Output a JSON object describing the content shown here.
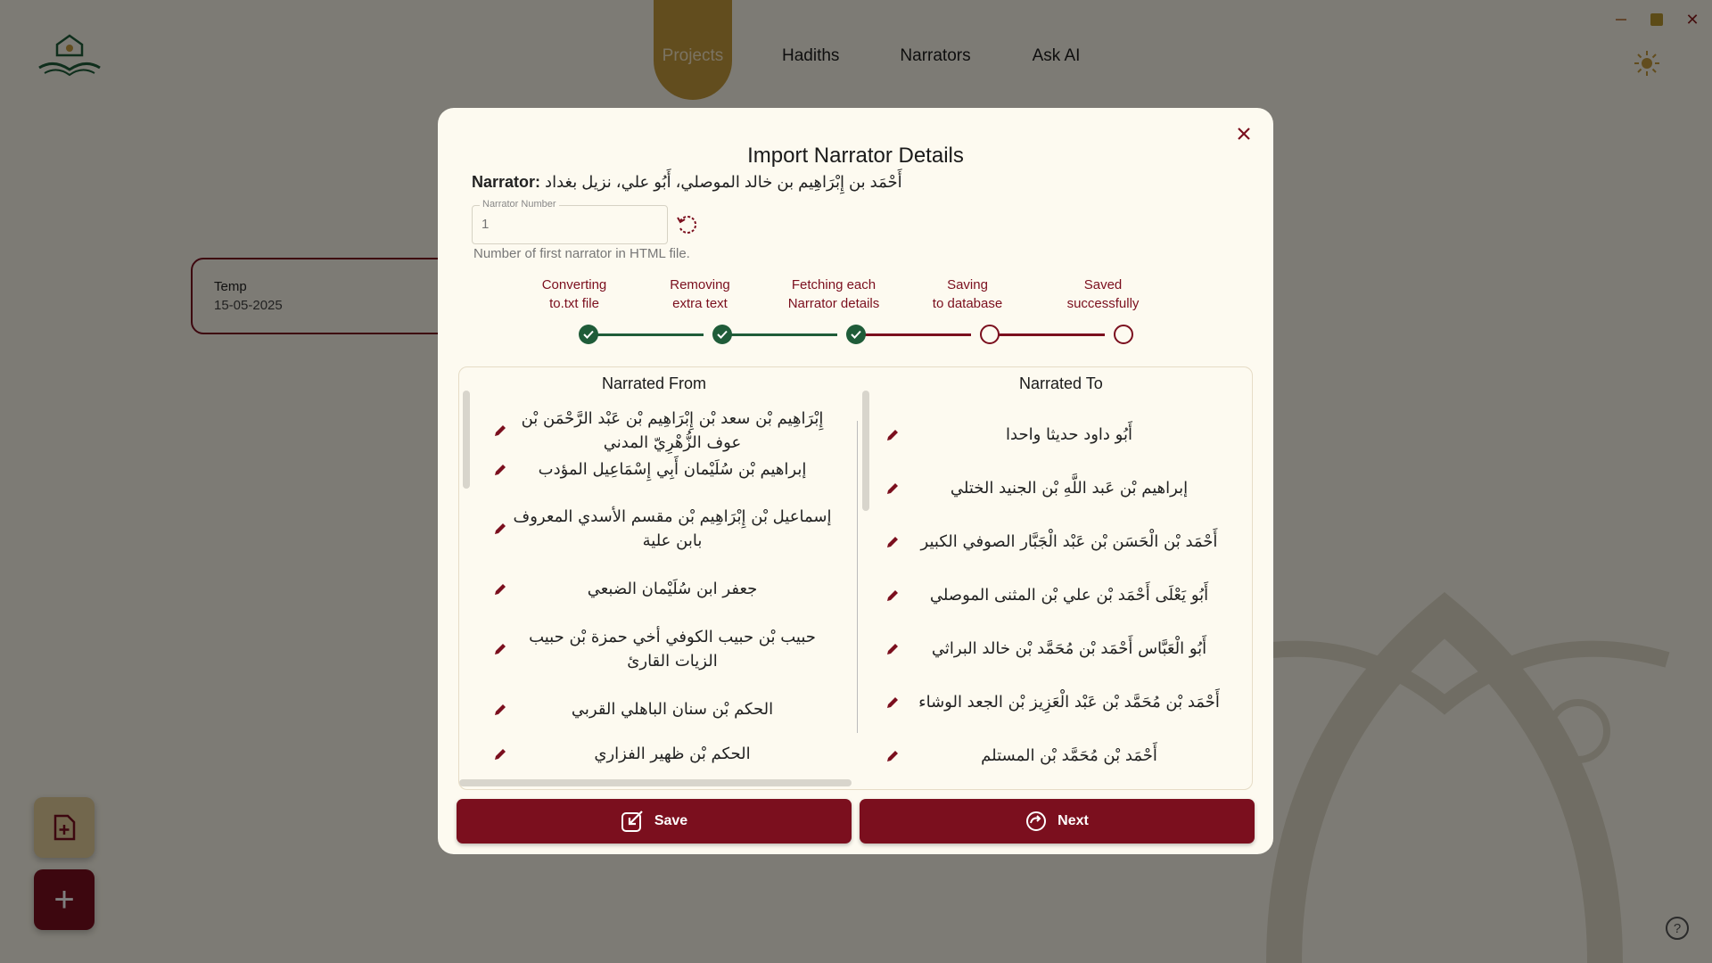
{
  "nav": {
    "items": [
      "Projects",
      "Hadiths",
      "Narrators",
      "Ask AI"
    ],
    "active": "Projects"
  },
  "project_card": {
    "name": "Temp",
    "date": "15-05-2025"
  },
  "colors": {
    "primary": "#7b0f1e",
    "success": "#1f5c39",
    "accent": "#c49a3c",
    "background": "#fbf7ea"
  },
  "modal": {
    "title": "Import Narrator Details",
    "narrator_label": "Narrator:",
    "narrator_value": "أَحْمَد بن إِبْرَاهِيم بن خالد الموصلي، أَبُو علي، نزيل بغداد",
    "number_field": {
      "label": "Narrator Number",
      "placeholder": "1"
    },
    "helper_text": "Number of first narrator in HTML file.",
    "steps": [
      {
        "line1": "Converting",
        "line2": "to.txt file",
        "done": true
      },
      {
        "line1": "Removing",
        "line2": "extra text",
        "done": true
      },
      {
        "line1": "Fetching each",
        "line2": "Narrator details",
        "done": true
      },
      {
        "line1": "Saving",
        "line2": "to database",
        "done": false
      },
      {
        "line1": "Saved",
        "line2": "successfully",
        "done": false
      }
    ],
    "narrated_from": {
      "heading": "Narrated From",
      "items": [
        "إِبْرَاهِيم بْن سعد بْن إِبْرَاهِيم بْن عَبْد الرَّحْمَن بْن عوف الزُّهْرِيّ المدني",
        "إبراهيم بْن سُلَيْمان أَبِي إِسْمَاعِيل المؤدب",
        "إسماعيل بْن إِبْرَاهِيم بْن مقسم الأسدي المعروف بابن علية",
        "جعفر ابن سُلَيْمان الضبعي",
        "حبيب بْن حبيب الكوفي أخي حمزة بْن حبيب الزيات القارئ",
        "الحكم بْن سنان الباهلي القربي",
        "الحكم بْن ظهير الفزاري"
      ]
    },
    "narrated_to": {
      "heading": "Narrated To",
      "items": [
        "أَبُو داود حديثا واحدا",
        "إبراهيم بْن عَبد اللَّهِ بْن الجنيد الختلي",
        "أَحْمَد بْن الْحَسَن بْن عَبْد الْجَبَّار الصوفي الكبير",
        "أَبُو يَعْلَى أَحْمَد بْن علي بْن المثنى الموصلي",
        "أَبُو الْعَبَّاس أَحْمَد بْن مُحَمَّد بْن خالد البراثي",
        "أَحْمَد بْن مُحَمَّد بْن عَبْد الْعَزِيز بْن الجعد الوشاء",
        "أَحْمَد بْن مُحَمَّد بْن المستلم"
      ]
    },
    "save_label": "Save",
    "next_label": "Next"
  }
}
